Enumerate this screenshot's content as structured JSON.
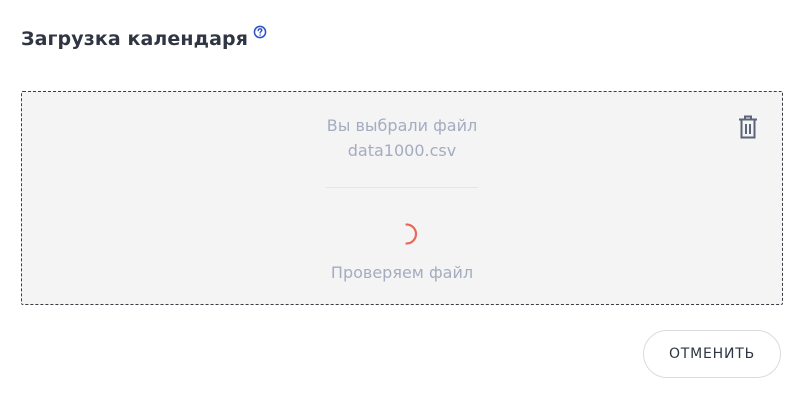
{
  "header": {
    "title": "Загрузка календаря",
    "help_icon": "question-circle-icon"
  },
  "dropzone": {
    "selected_prefix": "Вы выбрали файл",
    "file_name": "data1000.csv",
    "status_text": "Проверяем файл",
    "delete_icon": "trash-icon",
    "spinner_icon": "loading-spinner-icon"
  },
  "actions": {
    "cancel_label": "ОТМЕНИТЬ"
  },
  "colors": {
    "title": "#2f3542",
    "muted_text": "#a4acbf",
    "help_icon": "#2b4fc7",
    "spinner": "#e8685a",
    "dropzone_bg": "#f4f4f5"
  }
}
